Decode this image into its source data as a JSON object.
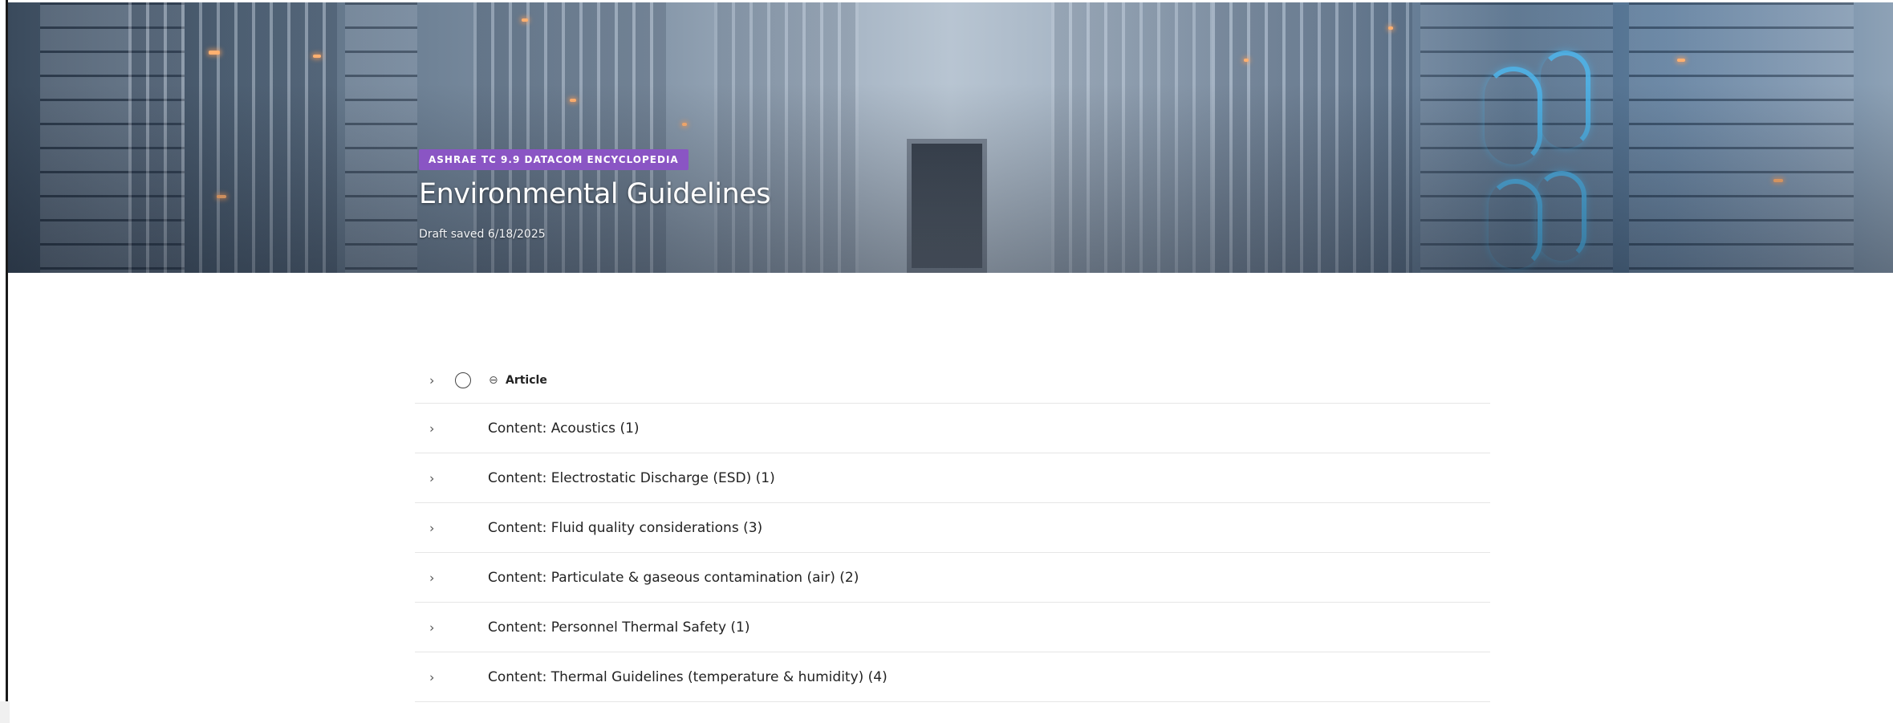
{
  "hero": {
    "badge": "ASHRAE TC 9.9 DATACOM ENCYCLOPEDIA",
    "title": "Environmental Guidelines",
    "draft_status": "Draft saved 6/18/2025"
  },
  "list": {
    "header_label": "Article",
    "rows": [
      {
        "label": "Content: Acoustics (1)"
      },
      {
        "label": "Content: Electrostatic Discharge (ESD) (1)"
      },
      {
        "label": "Content: Fluid quality considerations (3)"
      },
      {
        "label": "Content: Particulate & gaseous contamination (air) (2)"
      },
      {
        "label": "Content: Personnel Thermal Safety (1)"
      },
      {
        "label": "Content: Thermal Guidelines (temperature & humidity) (4)"
      }
    ]
  },
  "icons": {
    "chevron": "chevron-right-icon",
    "select": "radio-circle-icon",
    "link": "link-icon"
  },
  "colors": {
    "badge_bg": "#8a55c4",
    "text": "#222222",
    "divider": "#e6e6e6"
  }
}
